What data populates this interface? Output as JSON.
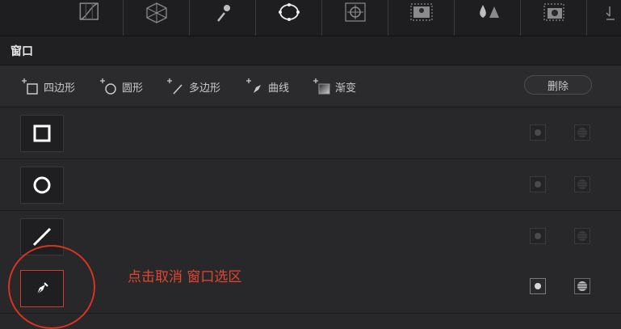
{
  "window_section": {
    "title": "窗口"
  },
  "toolbar_icons": [
    "curves-icon",
    "qualifier-mesh-icon",
    "eyedropper-icon",
    "window-circle-icon",
    "tracker-icon",
    "magic-mask-icon",
    "blur-icon",
    "key-icon",
    "sizing-icon"
  ],
  "shapes": {
    "square_label": "四边形",
    "circle_label": "圆形",
    "polygon_label": "多边形",
    "curve_label": "曲线",
    "gradient_label": "渐变",
    "delete_label": "删除"
  },
  "rows": [
    {
      "shape": "square-icon",
      "enabled": false
    },
    {
      "shape": "circle-icon",
      "enabled": false
    },
    {
      "shape": "line-icon",
      "enabled": false
    },
    {
      "shape": "pen-icon",
      "enabled": true,
      "selected": true
    }
  ],
  "annotation": {
    "text": "点击取消 窗口选区",
    "color": "#e0472f"
  },
  "colors": {
    "accent": "#d8341f",
    "background": "#28282b"
  }
}
